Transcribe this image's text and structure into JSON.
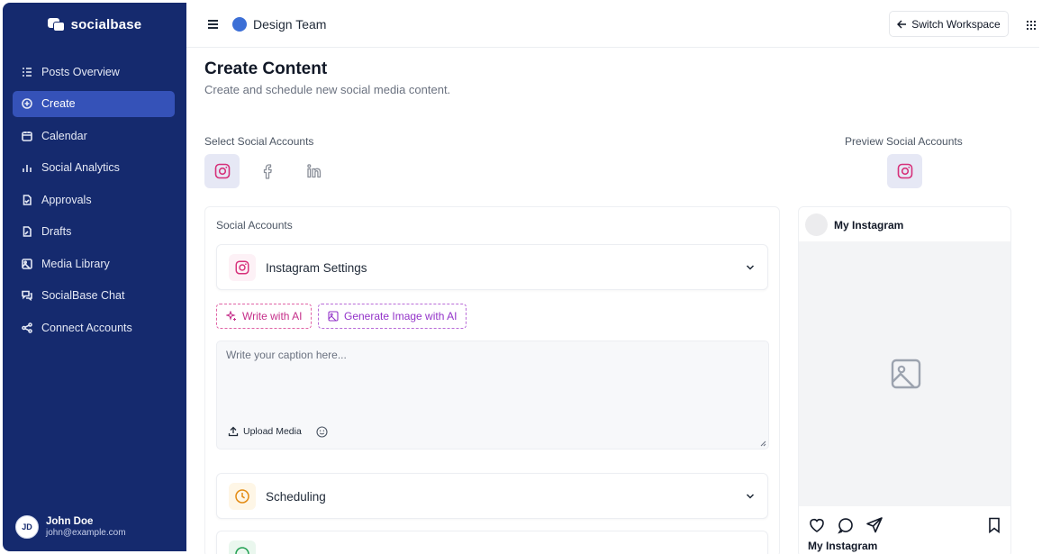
{
  "app": {
    "name": "socialbase"
  },
  "sidebar": {
    "items": [
      {
        "label": "Posts Overview",
        "icon": "list-icon",
        "active": false
      },
      {
        "label": "Create",
        "icon": "plus-circle-icon",
        "active": true
      },
      {
        "label": "Calendar",
        "icon": "calendar-icon",
        "active": false
      },
      {
        "label": "Social Analytics",
        "icon": "bar-chart-icon",
        "active": false
      },
      {
        "label": "Approvals",
        "icon": "file-check-icon",
        "active": false
      },
      {
        "label": "Drafts",
        "icon": "file-edit-icon",
        "active": false
      },
      {
        "label": "Media Library",
        "icon": "image-icon",
        "active": false
      },
      {
        "label": "SocialBase Chat",
        "icon": "chat-icon",
        "active": false
      },
      {
        "label": "Connect Accounts",
        "icon": "share-icon",
        "active": false
      }
    ],
    "user": {
      "initials": "JD",
      "name": "John Doe",
      "email": "john@example.com"
    }
  },
  "header": {
    "team_name": "Design Team",
    "team_color": "#3c6fd6",
    "switch_label": "Switch Workspace"
  },
  "main": {
    "title": "Create Content",
    "subtitle": "Create and schedule new social media content.",
    "select_label": "Select Social Accounts",
    "preview_label": "Preview Social Accounts",
    "card_label": "Social Accounts",
    "instagram_settings": "Instagram Settings",
    "write_ai": "Write with AI",
    "generate_ai": "Generate Image with AI",
    "caption_placeholder": "Write your caption here...",
    "upload_media": "Upload Media",
    "scheduling": "Scheduling"
  },
  "preview": {
    "account_name": "My Instagram",
    "footer_name": "My Instagram"
  },
  "colors": {
    "sidebar_bg": "#152a6e",
    "sidebar_active": "#3552b8",
    "instagram_pink": "#d6307a",
    "ai_pink": "#c52f8a",
    "ai_purple": "#9333c9",
    "schedule_orange": "#e38b13"
  }
}
